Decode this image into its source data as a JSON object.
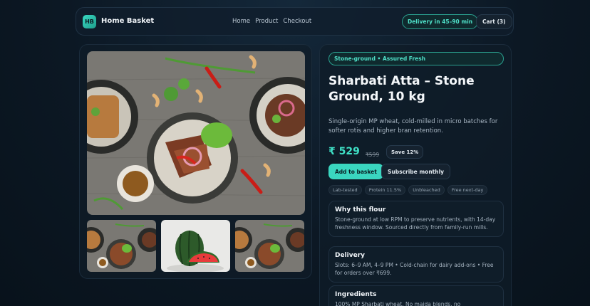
{
  "header": {
    "logo": "HB",
    "brand": "Home Basket",
    "nav": [
      "Home",
      "Product",
      "Checkout"
    ],
    "delivery": "Delivery in 45–90 min",
    "cart": "Cart (3)"
  },
  "gallery": {
    "main_image": "food-platter-image",
    "thumbnails": [
      "food-platter-thumbnail",
      "watermelon-thumbnail",
      "food-platter-thumbnail"
    ]
  },
  "product": {
    "tag": "Stone-ground • Assured Fresh",
    "title": "Sharbati Atta – Stone Ground, 10 kg",
    "description": "Single-origin MP wheat, cold-milled in micro batches for softer rotis and higher bran retention.",
    "price": "₹ 529",
    "old_price": "₹599",
    "save": "Save 12%",
    "add_button": "Add to basket",
    "subscribe_button": "Subscribe monthly",
    "chips": [
      "Lab-tested",
      "Protein 11.5%",
      "Unbleached",
      "Free next-day"
    ],
    "cards": [
      {
        "title": "Why this flour",
        "body": "Stone-ground at low RPM to preserve nutrients, with 14-day freshness window. Sourced directly from family-run mills."
      },
      {
        "title": "Delivery",
        "body": "Slots: 6–9 AM, 4–9 PM • Cold-chain for dairy add-ons • Free for orders over ₹699."
      },
      {
        "title": "Ingredients",
        "body": "100% MP Sharbati wheat. No maida blends, no"
      }
    ]
  },
  "colors": {
    "accent": "#3ad6bf",
    "background": "#0c1824",
    "surface": "#0f1d29"
  }
}
